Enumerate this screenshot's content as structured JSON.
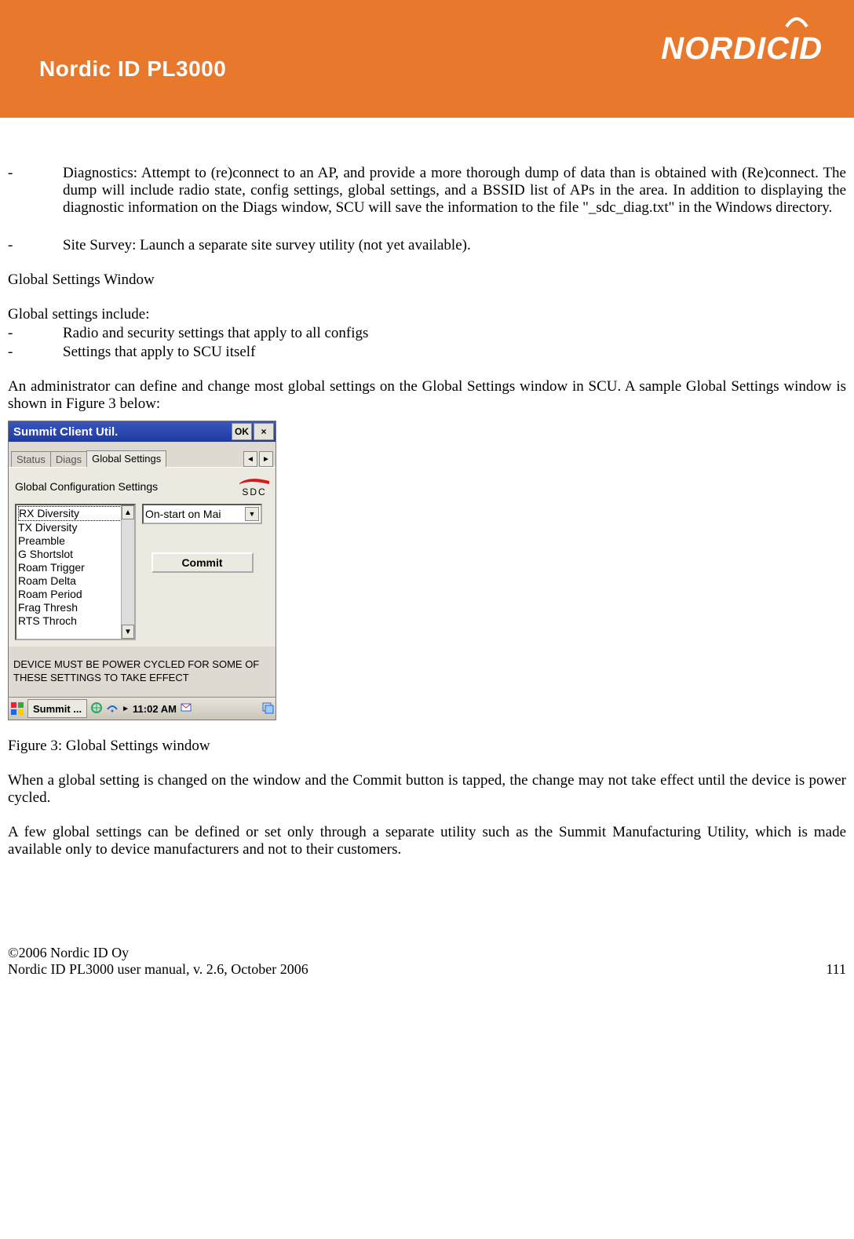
{
  "header": {
    "title": "Nordic ID PL3000",
    "brand": "NORDICID"
  },
  "body": {
    "bullet1": "Diagnostics: Attempt to (re)connect to an AP, and provide a more thorough dump of data than is obtained with (Re)connect.  The dump will include radio state, config settings, global settings, and a BSSID list of APs in the area.  In addition to displaying the diagnostic information on the Diags window, SCU will save the information to the file \"_sdc_diag.txt\" in the Windows directory.",
    "bullet2": "Site Survey: Launch a separate site survey utility (not yet available).",
    "gsw_heading": "Global Settings Window",
    "gs_include": "Global settings include:",
    "gs_b1": "Radio and security settings that apply to all configs",
    "gs_b2": "Settings that apply to SCU itself",
    "para_admin": "An administrator can define and change most global settings on the Global Settings window in SCU.  A sample Global Settings window is shown in Figure 3 below:",
    "fig_caption": "Figure 3: Global Settings window",
    "para_commit": "When a global setting is changed on the window and the Commit button is tapped, the change may not take effect until the device is power cycled.",
    "para_few": " A few global settings can be defined or set only through a separate utility such as the Summit Manufacturing Utility, which is made available only to device manufacturers and not to their customers."
  },
  "screenshot": {
    "window_title": "Summit Client Util.",
    "ok": "OK",
    "close": "×",
    "tabs": {
      "status": "Status",
      "diags": "Diags",
      "global": "Global Settings"
    },
    "config_title": "Global Configuration Settings",
    "sdc": "SDC",
    "list_items": [
      "RX Diversity",
      "TX Diversity",
      "Preamble",
      "G Shortslot",
      "Roam Trigger",
      "Roam Delta",
      "Roam Period",
      "Frag Thresh",
      "RTS Throch"
    ],
    "dropdown_value": "On-start on Mai",
    "commit": "Commit",
    "warning": "DEVICE MUST BE POWER CYCLED FOR SOME OF THESE SETTINGS TO TAKE EFFECT",
    "taskbar_app": "Summit ...",
    "time": "11:02 AM"
  },
  "footer": {
    "copyright": "©2006 Nordic ID Oy",
    "manual": "Nordic ID PL3000 user manual, v. 2.6, October 2006",
    "page": "111"
  }
}
